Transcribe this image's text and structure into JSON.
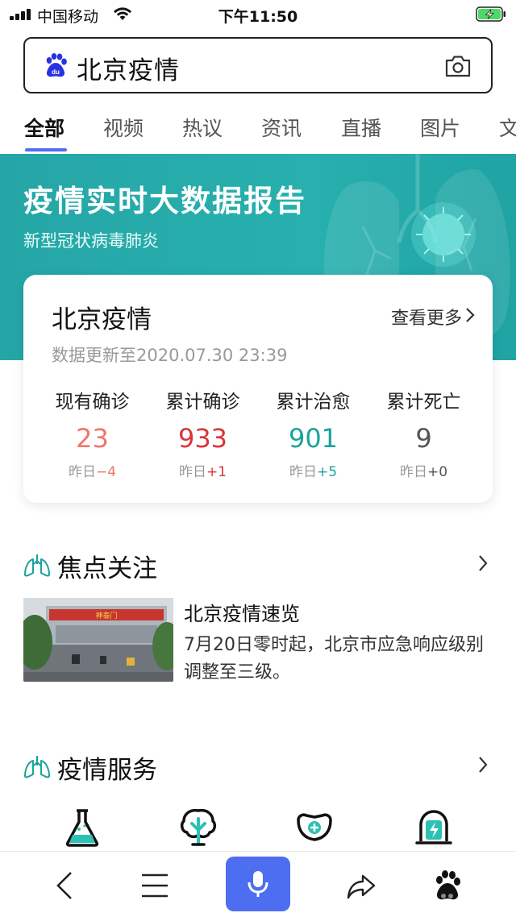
{
  "status_bar": {
    "carrier": "中国移动",
    "time": "下午11:50"
  },
  "search": {
    "query": "北京疫情"
  },
  "tabs": [
    {
      "label": "全部"
    },
    {
      "label": "视频"
    },
    {
      "label": "热议"
    },
    {
      "label": "资讯"
    },
    {
      "label": "直播"
    },
    {
      "label": "图片"
    },
    {
      "label": "文"
    }
  ],
  "banner": {
    "title": "疫情实时大数据报告",
    "subtitle": "新型冠状病毒肺炎"
  },
  "card": {
    "title": "北京疫情",
    "more": "查看更多",
    "updated": "数据更新至2020.07.30 23:39",
    "stats": [
      {
        "label": "现有确诊",
        "value": "23",
        "delta_prefix": "昨日",
        "delta": "−4",
        "color": "#f0766a",
        "delta_color": "#f0766a"
      },
      {
        "label": "累计确诊",
        "value": "933",
        "delta_prefix": "昨日",
        "delta": "+1",
        "color": "#d9353a",
        "delta_color": "#d9353a"
      },
      {
        "label": "累计治愈",
        "value": "901",
        "delta_prefix": "昨日",
        "delta": "+5",
        "color": "#1aa39b",
        "delta_color": "#1aa39b"
      },
      {
        "label": "累计死亡",
        "value": "9",
        "delta_prefix": "昨日",
        "delta": "+0",
        "color": "#555555",
        "delta_color": "#555555"
      }
    ]
  },
  "focus": {
    "title": "焦点关注",
    "news": {
      "title": "北京疫情速览",
      "body": "7月20日零时起，北京市应急响应级别调整至三级。",
      "thumb_sign": "神泰门"
    }
  },
  "services": {
    "title": "疫情服务",
    "icons": [
      "flask-icon",
      "broccoli-icon",
      "mask-icon",
      "alarm-icon"
    ]
  },
  "bottom_bar": {
    "icons": [
      "back-icon",
      "menu-icon",
      "microphone-icon",
      "share-icon",
      "baidu-paw-icon"
    ]
  },
  "colors": {
    "accent": "#4e6ef2",
    "banner": "#27b0ae"
  }
}
